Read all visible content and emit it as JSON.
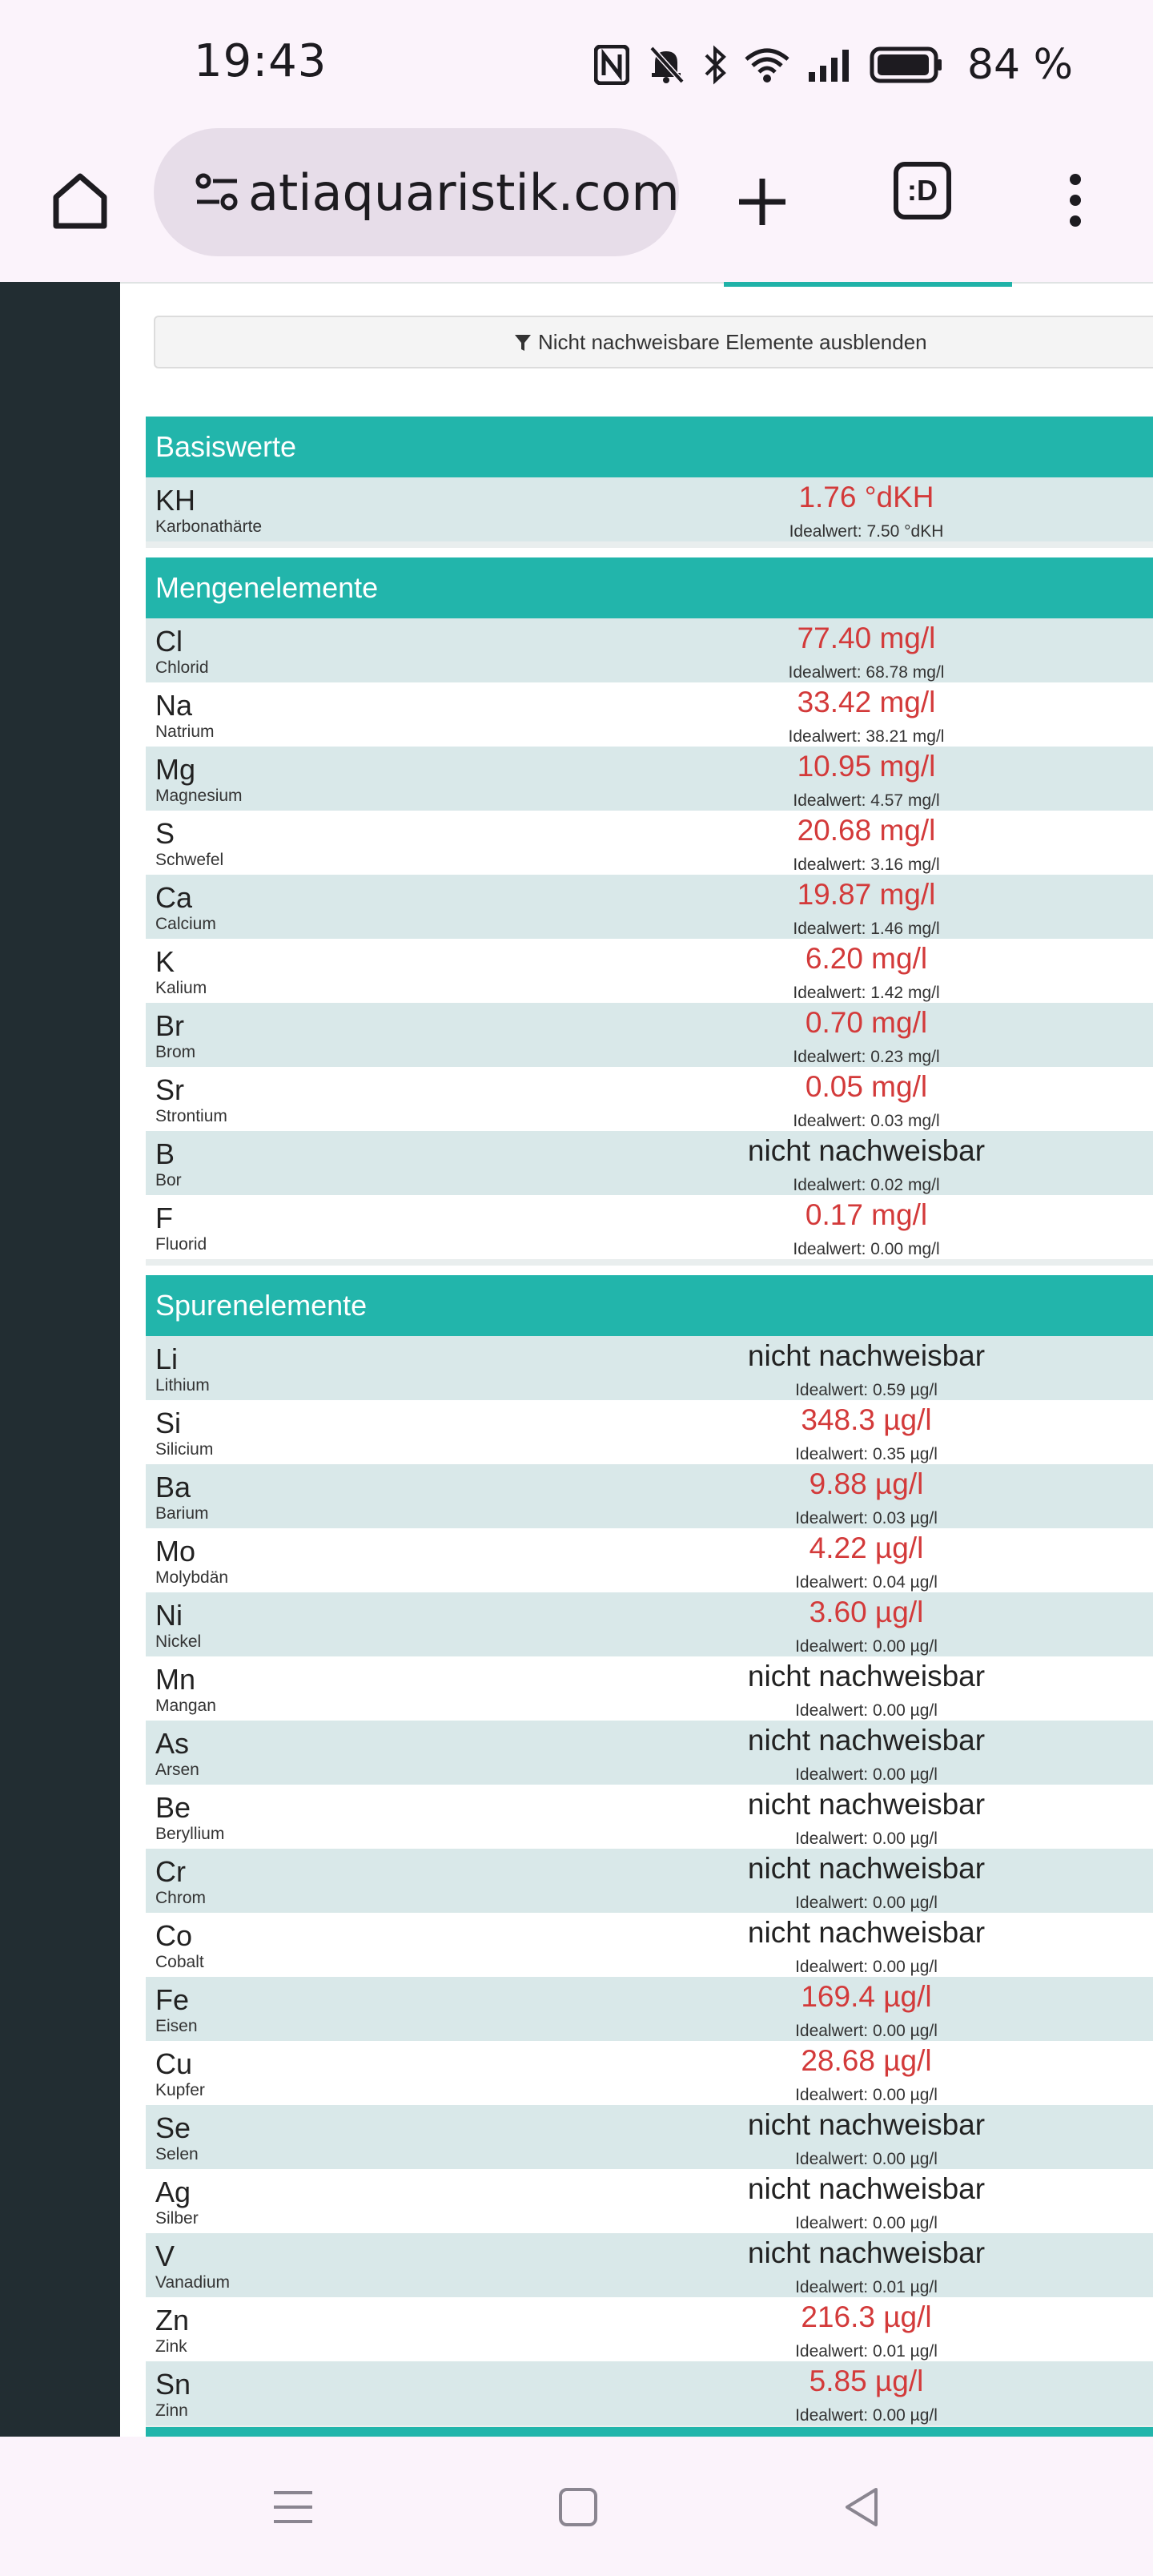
{
  "status": {
    "time": "19:43",
    "battery_percent": "84 %",
    "icons": [
      "nfc-icon",
      "bell-muted-icon",
      "bluetooth-icon",
      "wifi-icon",
      "signal-icon",
      "battery-icon"
    ]
  },
  "browser": {
    "url": "atiaquaristik.com",
    "tabs_label": ":D"
  },
  "filter": {
    "label": "Nicht nachweisbare Elemente ausblenden"
  },
  "colors": {
    "accent": "#22b5ab",
    "sidebar": "#222d32",
    "value_out_of_range": "#d33a3a"
  },
  "sections": [
    {
      "title": "Basiswerte",
      "rows": [
        {
          "sym": "KH",
          "name": "Karbonathärte",
          "value": "1.76 °dKH",
          "ideal": "Idealwert: 7.50 °dKH",
          "status": "red"
        }
      ]
    },
    {
      "title": "Mengenelemente",
      "rows": [
        {
          "sym": "Cl",
          "name": "Chlorid",
          "value": "77.40 mg/l",
          "ideal": "Idealwert: 68.78 mg/l",
          "status": "red"
        },
        {
          "sym": "Na",
          "name": "Natrium",
          "value": "33.42 mg/l",
          "ideal": "Idealwert: 38.21 mg/l",
          "status": "red"
        },
        {
          "sym": "Mg",
          "name": "Magnesium",
          "value": "10.95 mg/l",
          "ideal": "Idealwert: 4.57 mg/l",
          "status": "red"
        },
        {
          "sym": "S",
          "name": "Schwefel",
          "value": "20.68 mg/l",
          "ideal": "Idealwert: 3.16 mg/l",
          "status": "red"
        },
        {
          "sym": "Ca",
          "name": "Calcium",
          "value": "19.87 mg/l",
          "ideal": "Idealwert: 1.46 mg/l",
          "status": "red"
        },
        {
          "sym": "K",
          "name": "Kalium",
          "value": "6.20 mg/l",
          "ideal": "Idealwert: 1.42 mg/l",
          "status": "red"
        },
        {
          "sym": "Br",
          "name": "Brom",
          "value": "0.70 mg/l",
          "ideal": "Idealwert: 0.23 mg/l",
          "status": "red"
        },
        {
          "sym": "Sr",
          "name": "Strontium",
          "value": "0.05 mg/l",
          "ideal": "Idealwert: 0.03 mg/l",
          "status": "red"
        },
        {
          "sym": "B",
          "name": "Bor",
          "value": "nicht nachweisbar",
          "ideal": "Idealwert: 0.02 mg/l",
          "status": "dark"
        },
        {
          "sym": "F",
          "name": "Fluorid",
          "value": "0.17 mg/l",
          "ideal": "Idealwert: 0.00 mg/l",
          "status": "red"
        }
      ]
    },
    {
      "title": "Spurenelemente",
      "rows": [
        {
          "sym": "Li",
          "name": "Lithium",
          "value": "nicht nachweisbar",
          "ideal": "Idealwert: 0.59 µg/l",
          "status": "dark"
        },
        {
          "sym": "Si",
          "name": "Silicium",
          "value": "348.3 µg/l",
          "ideal": "Idealwert: 0.35 µg/l",
          "status": "red"
        },
        {
          "sym": "Ba",
          "name": "Barium",
          "value": "9.88 µg/l",
          "ideal": "Idealwert: 0.03 µg/l",
          "status": "red"
        },
        {
          "sym": "Mo",
          "name": "Molybdän",
          "value": "4.22 µg/l",
          "ideal": "Idealwert: 0.04 µg/l",
          "status": "red"
        },
        {
          "sym": "Ni",
          "name": "Nickel",
          "value": "3.60 µg/l",
          "ideal": "Idealwert: 0.00 µg/l",
          "status": "red"
        },
        {
          "sym": "Mn",
          "name": "Mangan",
          "value": "nicht nachweisbar",
          "ideal": "Idealwert: 0.00 µg/l",
          "status": "dark"
        },
        {
          "sym": "As",
          "name": "Arsen",
          "value": "nicht nachweisbar",
          "ideal": "Idealwert: 0.00 µg/l",
          "status": "dark"
        },
        {
          "sym": "Be",
          "name": "Beryllium",
          "value": "nicht nachweisbar",
          "ideal": "Idealwert: 0.00 µg/l",
          "status": "dark"
        },
        {
          "sym": "Cr",
          "name": "Chrom",
          "value": "nicht nachweisbar",
          "ideal": "Idealwert: 0.00 µg/l",
          "status": "dark"
        },
        {
          "sym": "Co",
          "name": "Cobalt",
          "value": "nicht nachweisbar",
          "ideal": "Idealwert: 0.00 µg/l",
          "status": "dark"
        },
        {
          "sym": "Fe",
          "name": "Eisen",
          "value": "169.4 µg/l",
          "ideal": "Idealwert: 0.00 µg/l",
          "status": "red"
        },
        {
          "sym": "Cu",
          "name": "Kupfer",
          "value": "28.68 µg/l",
          "ideal": "Idealwert: 0.00 µg/l",
          "status": "red"
        },
        {
          "sym": "Se",
          "name": "Selen",
          "value": "nicht nachweisbar",
          "ideal": "Idealwert: 0.00 µg/l",
          "status": "dark"
        },
        {
          "sym": "Ag",
          "name": "Silber",
          "value": "nicht nachweisbar",
          "ideal": "Idealwert: 0.00 µg/l",
          "status": "dark"
        },
        {
          "sym": "V",
          "name": "Vanadium",
          "value": "nicht nachweisbar",
          "ideal": "Idealwert: 0.01 µg/l",
          "status": "dark"
        },
        {
          "sym": "Zn",
          "name": "Zink",
          "value": "216.3 µg/l",
          "ideal": "Idealwert: 0.01 µg/l",
          "status": "red"
        },
        {
          "sym": "Sn",
          "name": "Zinn",
          "value": "5.85 µg/l",
          "ideal": "Idealwert: 0.00 µg/l",
          "status": "red"
        }
      ]
    }
  ],
  "navbar": {
    "icons": [
      "menu-icon",
      "home-square-icon",
      "back-icon"
    ]
  }
}
